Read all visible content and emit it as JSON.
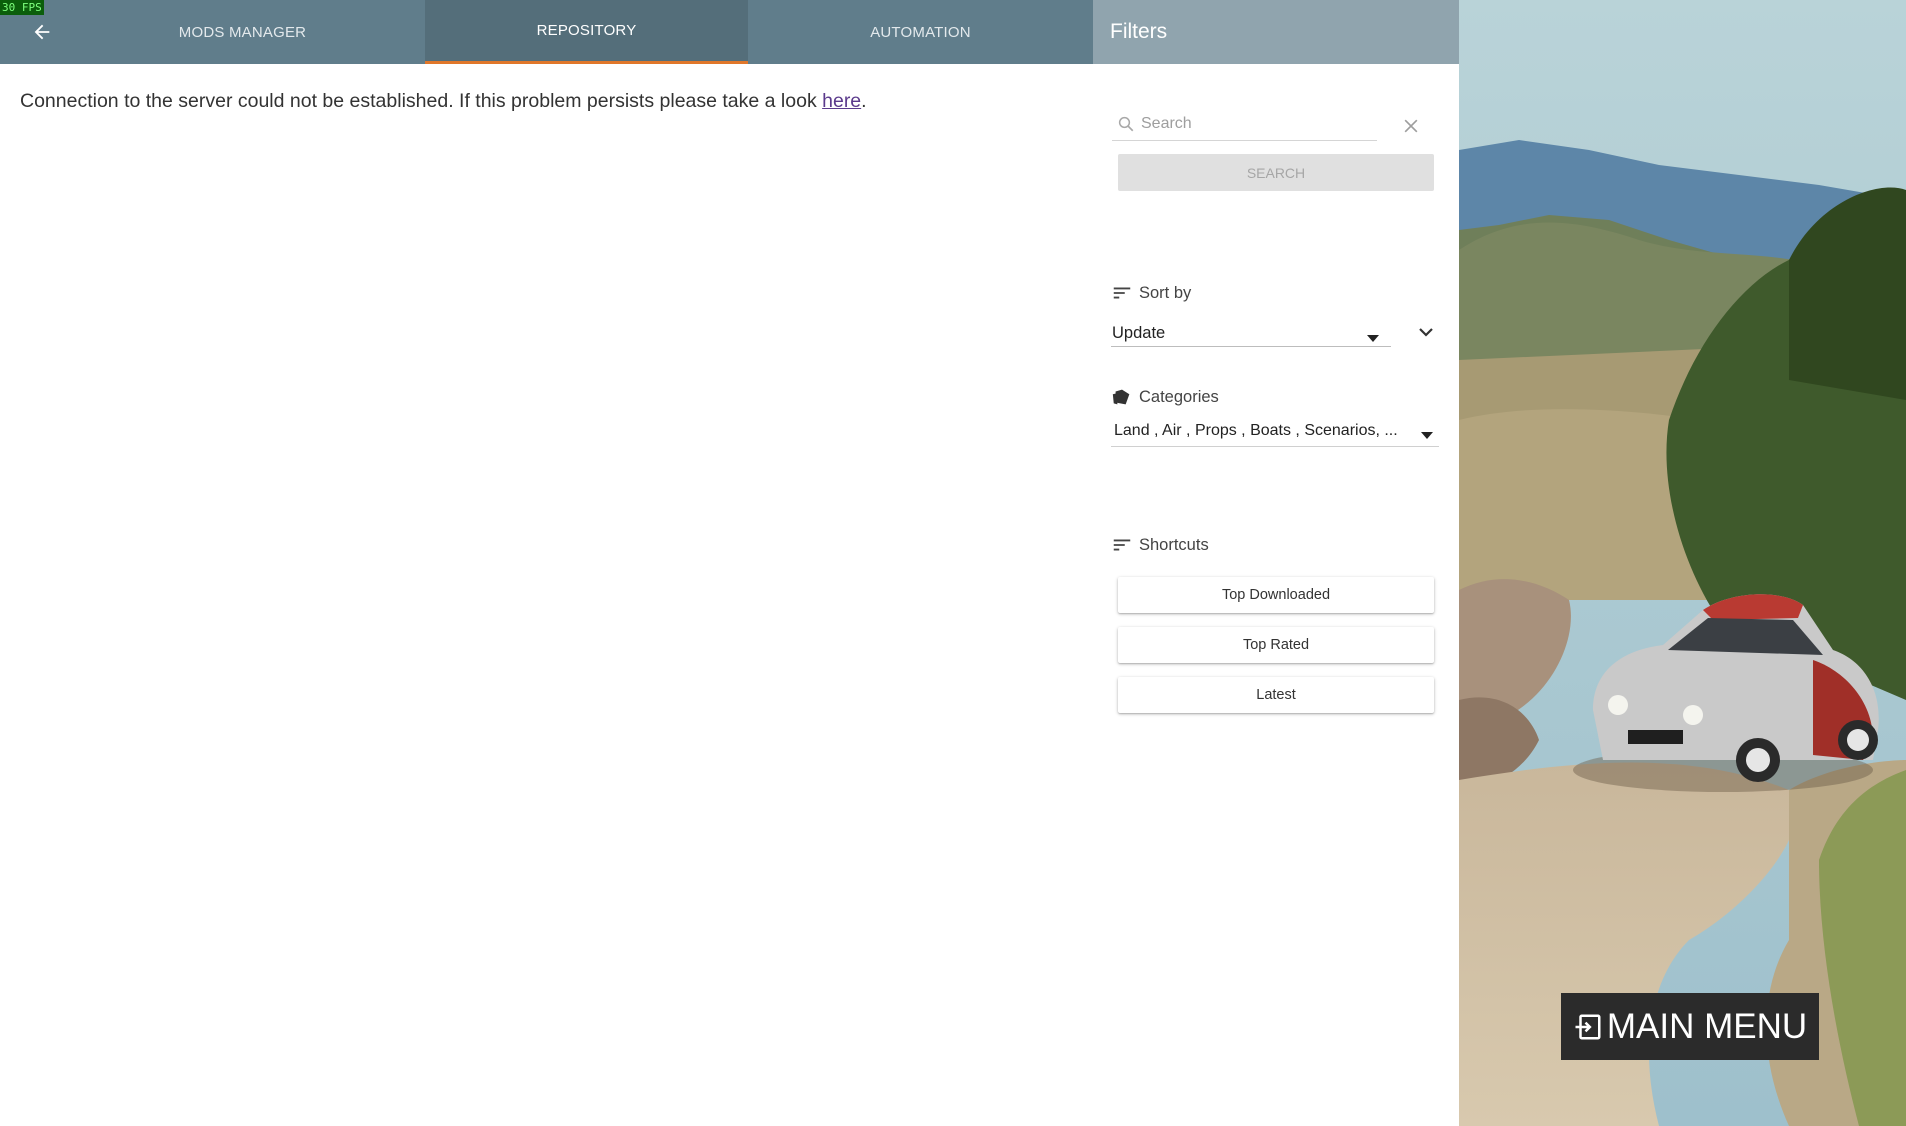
{
  "fps_counter": "30 FPS",
  "nav": {
    "back_icon": "arrow-left-icon",
    "tabs": [
      {
        "label": "MODS MANAGER",
        "active": false
      },
      {
        "label": "REPOSITORY",
        "active": true
      },
      {
        "label": "AUTOMATION",
        "active": false
      }
    ]
  },
  "main": {
    "message_text": "Connection to the server could not be established. If this problem persists please take a look ",
    "message_link": "here",
    "message_end": "."
  },
  "filters": {
    "title": "Filters",
    "search": {
      "placeholder": "Search",
      "value": "",
      "button_label": "SEARCH",
      "icons": [
        "search-icon",
        "close-icon"
      ]
    },
    "sort": {
      "label": "Sort by",
      "selected": "Update",
      "icons": [
        "sort-icon",
        "caret-down-icon",
        "chevron-down-icon"
      ]
    },
    "categories": {
      "label": "Categories",
      "selected": "Land , Air , Props , Boats , Scenarios, ...",
      "icons": [
        "tags-icon",
        "caret-down-icon"
      ]
    },
    "shortcuts": {
      "label": "Shortcuts",
      "items": [
        "Top Downloaded",
        "Top Rated",
        "Latest"
      ]
    }
  },
  "main_menu": {
    "label": "MAIN MENU",
    "icon": "exit-icon"
  },
  "colors": {
    "topbar": "#607d8b",
    "active_tab": "#546e7a",
    "tab_indicator": "#e0772a",
    "filters_header": "#90a4ae",
    "link": "#5b3a8c"
  }
}
